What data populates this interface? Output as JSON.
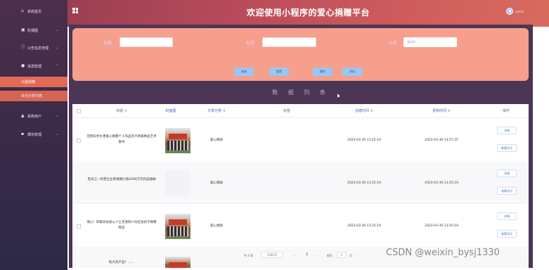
{
  "header": {
    "title": "欢迎使用小程序的爱心捐赠平台",
    "user": "admin"
  },
  "sidebar": {
    "items": [
      {
        "icon": "home-icon",
        "glyph": "⌂",
        "label": "系统首页",
        "chevron": ""
      },
      {
        "icon": "image-icon",
        "glyph": "▣",
        "label": "轮播图",
        "chevron": "⌄"
      },
      {
        "icon": "info-circle-icon",
        "glyph": "ⓘ",
        "label": "公告信息管理",
        "chevron": "⌄"
      },
      {
        "icon": "map-pin-icon",
        "glyph": "●",
        "label": "资源管理",
        "chevron": "⌃"
      },
      {
        "icon": "user-icon",
        "glyph": "▲",
        "label": "系统用户",
        "chevron": "⌄"
      },
      {
        "icon": "grid-icon",
        "glyph": "▪",
        "label": "模块管理",
        "chevron": "⌄"
      }
    ],
    "subitems": [
      "公益政策",
      "资讯分类列表"
    ]
  },
  "search": {
    "title_label": "标题",
    "tags_label": "标签",
    "category_label": "分类",
    "category_placeholder": "请选择",
    "buttons": {
      "query": "查询",
      "reset": "重置",
      "delete": "删除",
      "add": "添加"
    }
  },
  "table": {
    "section_title": "数 据 列 表",
    "columns": {
      "title": "标题 ⇕",
      "cover": "封面图",
      "category": "文章分类 ⇕",
      "tags": "标签",
      "created": "创建时间 ⇕",
      "updated": "更新时间 ⇕",
      "action": "操作"
    },
    "rows": [
      {
        "title": "范德农村乡建爱心捐赠个人作品及千余册精品艺术图书",
        "cover": "img",
        "category": "爱心捐助",
        "tags": "",
        "created": "2023-03-30 13:25:19",
        "updated": "2023-03-30 13:27:25"
      },
      {
        "title": "黑龙江一民营企业家捐赠价值2000万元药品器械",
        "cover": "blank",
        "category": "爱心捐助",
        "tags": "",
        "created": "2023-03-30 13:25:19",
        "updated": "2023-03-30 13:25:19"
      },
      {
        "title": "情心！四家协会爱心人士走进四川为社会孩子捐赠物资",
        "cover": "img",
        "category": "爱心捐助",
        "tags": "",
        "created": "2023-03-30 13:25:19",
        "updated": "2023-03-30 13:25:19"
      },
      {
        "title": "助力农产品！……",
        "cover": "img",
        "category": "",
        "tags": "",
        "created": "",
        "updated": ""
      }
    ],
    "action_labels": {
      "detail": "详情",
      "comment": "查看评论"
    }
  },
  "pager": {
    "total": "共 4 条",
    "per_page": "10条/页",
    "prev": "‹",
    "page": "1",
    "next": "›",
    "goto": "前往",
    "goto_value": "1",
    "page_unit": "页"
  },
  "watermark": "CSDN @weixin_bysj1330"
}
